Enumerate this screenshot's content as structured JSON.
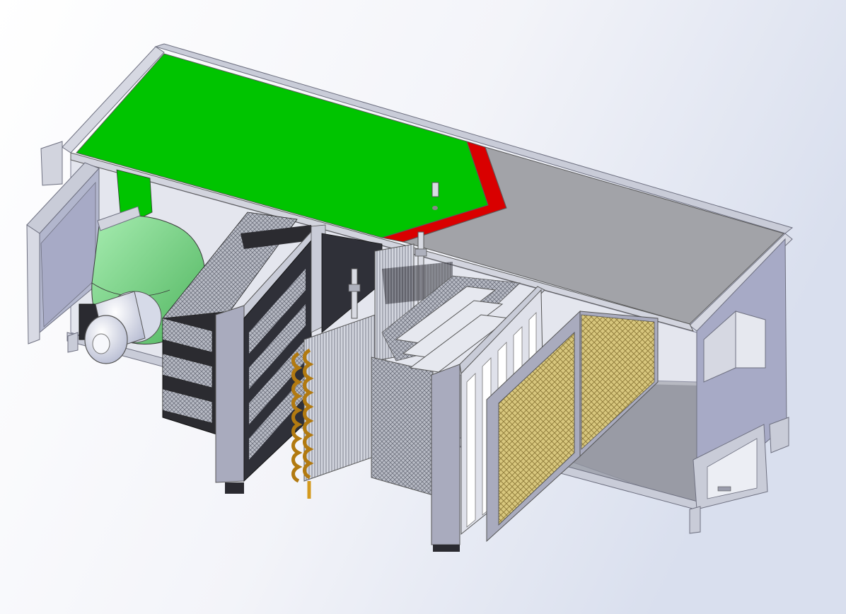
{
  "scene": {
    "subject": "air-handling-unit-cutaway",
    "colors": {
      "background_light": "#ffffff",
      "background_tint": "#dde2ee",
      "frame": "#c9ccd8",
      "frame_dark": "#8e90a3",
      "panel_green": "#00c400",
      "panel_red": "#d90000",
      "panel_grey": "#a2a3a8",
      "fan_green": "#7ed38a",
      "motor_light": "#e8ebf5",
      "filter_black": "#2b2b30",
      "coil_copper": "#d49a1e",
      "coil_fin": "#c8cbd6",
      "media_yellow": "#d6c47a",
      "end_panel": "#a7aac6"
    }
  }
}
